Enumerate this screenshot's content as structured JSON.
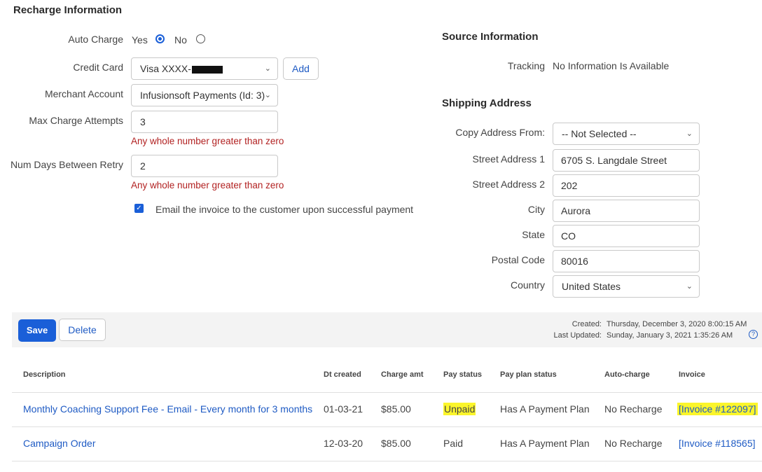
{
  "recharge": {
    "title": "Recharge Information",
    "auto_charge": {
      "label": "Auto Charge",
      "yes": "Yes",
      "no": "No"
    },
    "credit_card": {
      "label": "Credit Card",
      "value": "Visa XXXX-",
      "add": "Add"
    },
    "merchant": {
      "label": "Merchant Account",
      "value": "Infusionsoft Payments (Id: 3)"
    },
    "max_attempts": {
      "label": "Max Charge Attempts",
      "value": "3",
      "hint": "Any whole number greater than zero"
    },
    "retry_days": {
      "label": "Num Days Between Retry",
      "value": "2",
      "hint": "Any whole number greater than zero"
    },
    "email_invoice": "Email the invoice to the customer upon successful payment"
  },
  "source": {
    "title": "Source Information",
    "tracking_label": "Tracking",
    "tracking_value": "No Information Is Available"
  },
  "shipping": {
    "title": "Shipping Address",
    "copy_label": "Copy Address From:",
    "copy_value": "-- Not Selected --",
    "street1_label": "Street Address 1",
    "street1": "6705 S. Langdale Street",
    "street2_label": "Street Address 2",
    "street2": "202",
    "city_label": "City",
    "city": "Aurora",
    "state_label": "State",
    "state": "CO",
    "postal_label": "Postal Code",
    "postal": "80016",
    "country_label": "Country",
    "country": "United States"
  },
  "actions": {
    "save": "Save",
    "delete": "Delete"
  },
  "meta": {
    "created_label": "Created:",
    "created": "Thursday, December 3, 2020 8:00:15 AM",
    "updated_label": "Last Updated:",
    "updated": "Sunday, January 3, 2021 1:35:26 AM",
    "help": "?"
  },
  "table": {
    "headers": [
      "Description",
      "Dt created",
      "Charge amt",
      "Pay status",
      "Pay plan status",
      "Auto-charge",
      "Invoice"
    ],
    "rows": [
      {
        "description": "Monthly Coaching Support Fee - Email - Every month for 3 months",
        "date": "01-03-21",
        "amount": "$85.00",
        "pay_status": "Unpaid",
        "plan_status": "Has A Payment Plan",
        "auto_charge": "No Recharge",
        "invoice": "[Invoice #122097]"
      },
      {
        "description": "Campaign Order",
        "date": "12-03-20",
        "amount": "$85.00",
        "pay_status": "Paid",
        "plan_status": "Has A Payment Plan",
        "auto_charge": "No Recharge",
        "invoice": "[Invoice #118565]"
      }
    ]
  },
  "colors": {
    "accent": "#1a5fd8",
    "link": "#1f5bc4",
    "error": "#b22222",
    "highlight": "#fbf52b"
  }
}
